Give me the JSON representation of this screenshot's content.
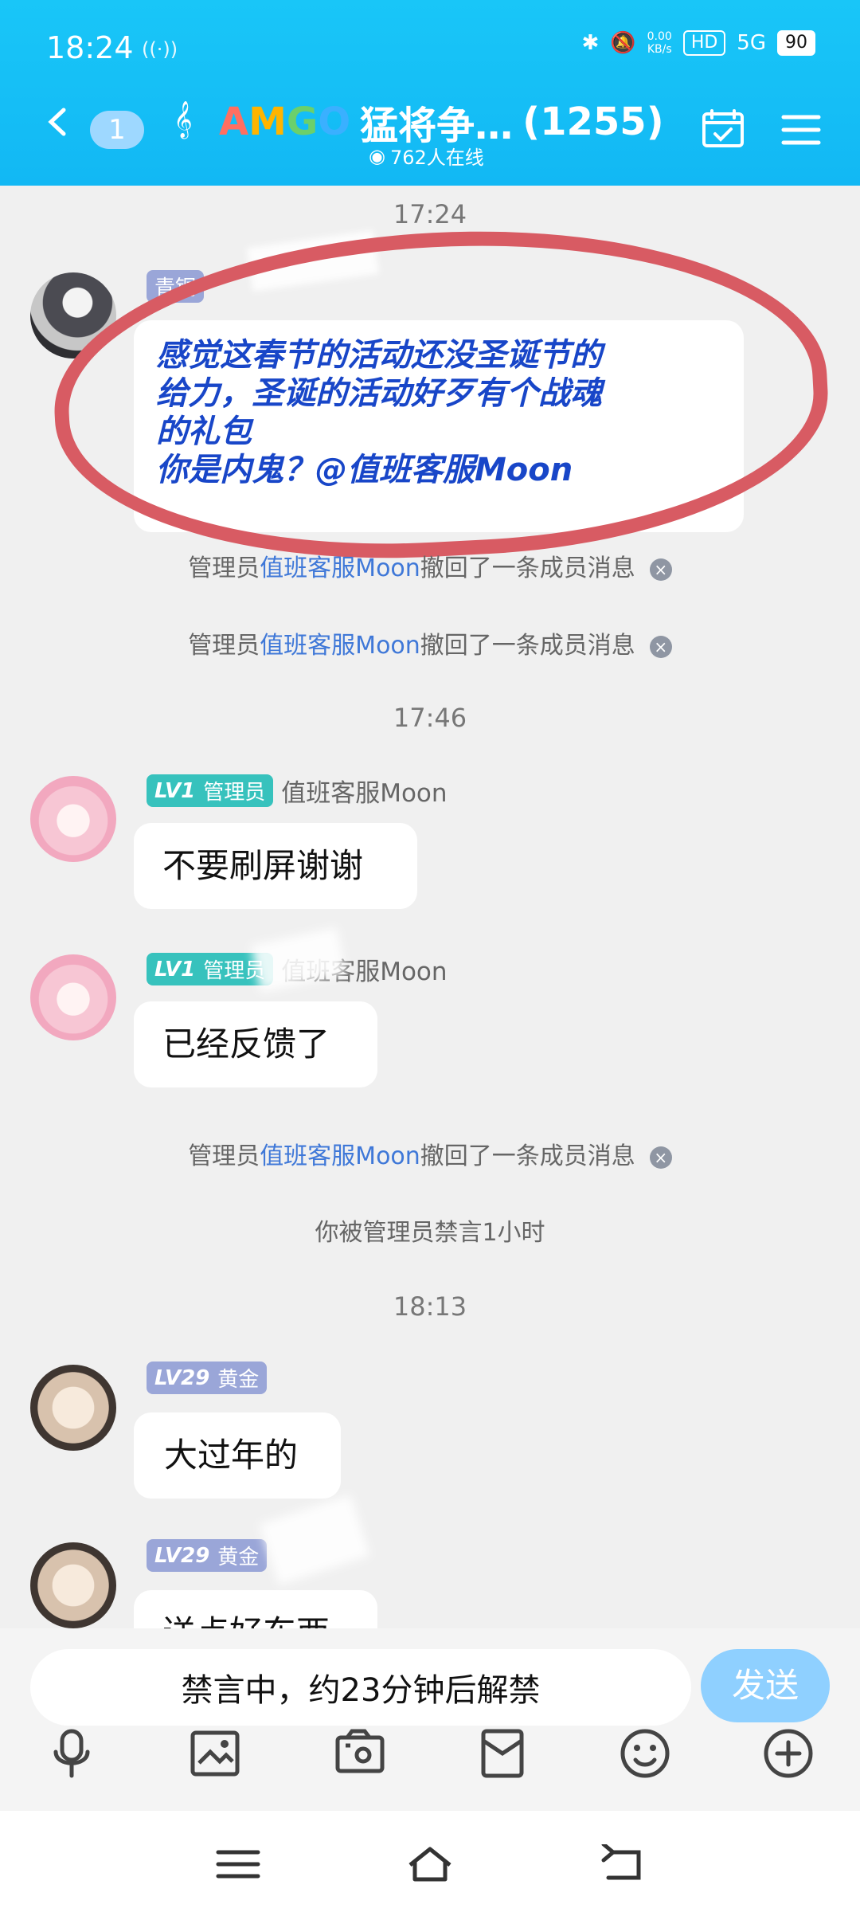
{
  "status": {
    "time": "18:24",
    "net_speed": "0.00",
    "net_unit": "KB/s",
    "hd": "HD",
    "signal": "5G",
    "battery": "90"
  },
  "header": {
    "unread": "1",
    "title": "猛将争…",
    "count": "(1255)",
    "online": "762人在线"
  },
  "times": {
    "t1": "17:24",
    "t2": "17:46",
    "t3": "18:13"
  },
  "messages": [
    {
      "sender": "青铜",
      "text_lines": [
        "感觉这春节的活动还没圣诞节的",
        "给力，圣诞的活动好歹有个战魂",
        "的礼包",
        "你是内鬼？@值班客服Moon"
      ]
    },
    {
      "level": "LV1",
      "role": "管理员",
      "sender": "值班客服Moon",
      "text": "不要刷屏谢谢"
    },
    {
      "level": "LV1",
      "role": "管理员",
      "sender": "值班客服Moon",
      "text": "已经反馈了"
    },
    {
      "level": "LV29",
      "role": "黄金",
      "sender": "",
      "text": "大过年的"
    },
    {
      "level": "LV29",
      "role": "黄金",
      "sender": "",
      "text": "送点好东西"
    }
  ],
  "system": {
    "admin": "管理员",
    "moon": "值班客服Moon",
    "recall": "撤回了一条成员消息",
    "mute": "你被管理员禁言1小时"
  },
  "input": {
    "placeholder": "禁言中，约23分钟后解禁",
    "send": "发送"
  },
  "icons": [
    "microphone-icon",
    "image-icon",
    "camera-icon",
    "red-packet-icon",
    "emoji-icon",
    "plus-icon",
    "menu-icon",
    "home-icon",
    "back-icon"
  ]
}
